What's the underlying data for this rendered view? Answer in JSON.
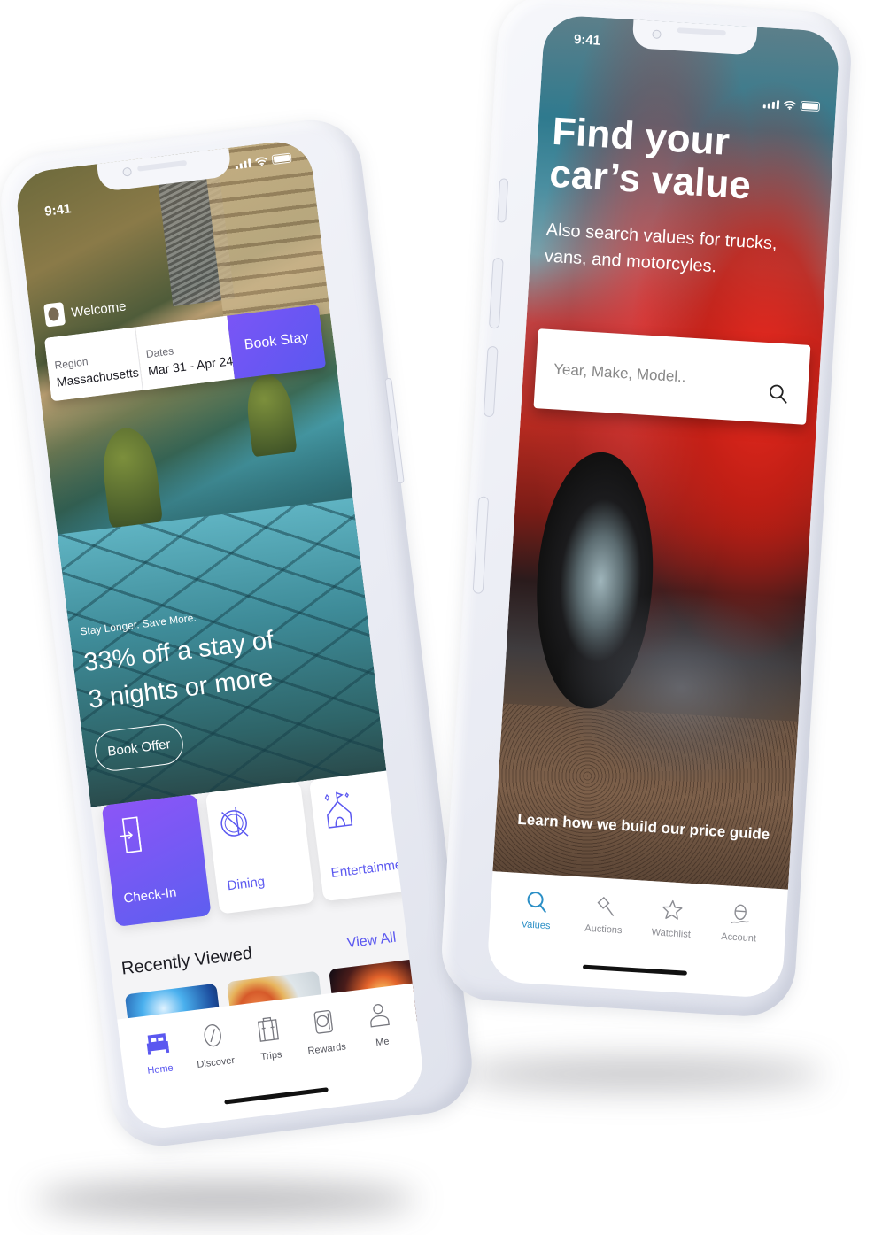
{
  "left_phone": {
    "status_time": "9:41",
    "welcome": "Welcome",
    "booking": {
      "region_label": "Region",
      "region_value": "Massachusetts",
      "dates_label": "Dates",
      "dates_value": "Mar 31 - Apr 24",
      "book_stay_label": "Book Stay"
    },
    "promo": {
      "kicker": "Stay Longer. Save More.",
      "headline_line1": "33% off a stay of",
      "headline_line2": "3 nights or more",
      "cta_label": "Book Offer"
    },
    "categories": [
      {
        "label": "Check-In",
        "icon": "door-enter-icon",
        "active": true
      },
      {
        "label": "Dining",
        "icon": "plate-fork-knife-icon",
        "active": false
      },
      {
        "label": "Entertainment",
        "icon": "circus-tent-icon",
        "active": false
      }
    ],
    "recently_viewed": {
      "title": "Recently Viewed",
      "view_all_label": "View All",
      "items": [
        {
          "kind": "concert"
        },
        {
          "kind": "food"
        },
        {
          "kind": "show"
        }
      ]
    },
    "tabbar": [
      {
        "label": "Home",
        "icon": "bed-icon",
        "active": true
      },
      {
        "label": "Discover",
        "icon": "compass-icon",
        "active": false
      },
      {
        "label": "Trips",
        "icon": "suitcase-icon",
        "active": false
      },
      {
        "label": "Rewards",
        "icon": "rewards-card-icon",
        "active": false
      },
      {
        "label": "Me",
        "icon": "person-icon",
        "active": false
      }
    ],
    "accent_color": "#5b58f0"
  },
  "right_phone": {
    "status_time": "9:41",
    "title_line1": "Find your",
    "title_line2": "car’s value",
    "subtitle": "Also search values for trucks, vans, and motorcyles.",
    "search": {
      "placeholder": "Year, Make, Model..",
      "value": ""
    },
    "price_guide_link": "Learn how we build our price guide",
    "tabbar": [
      {
        "label": "Values",
        "icon": "search-icon",
        "active": true
      },
      {
        "label": "Auctions",
        "icon": "gavel-icon",
        "active": false
      },
      {
        "label": "Watchlist",
        "icon": "star-icon",
        "active": false
      },
      {
        "label": "Account",
        "icon": "account-helmet-icon",
        "active": false
      }
    ],
    "accent_color": "#2b8fc6"
  }
}
